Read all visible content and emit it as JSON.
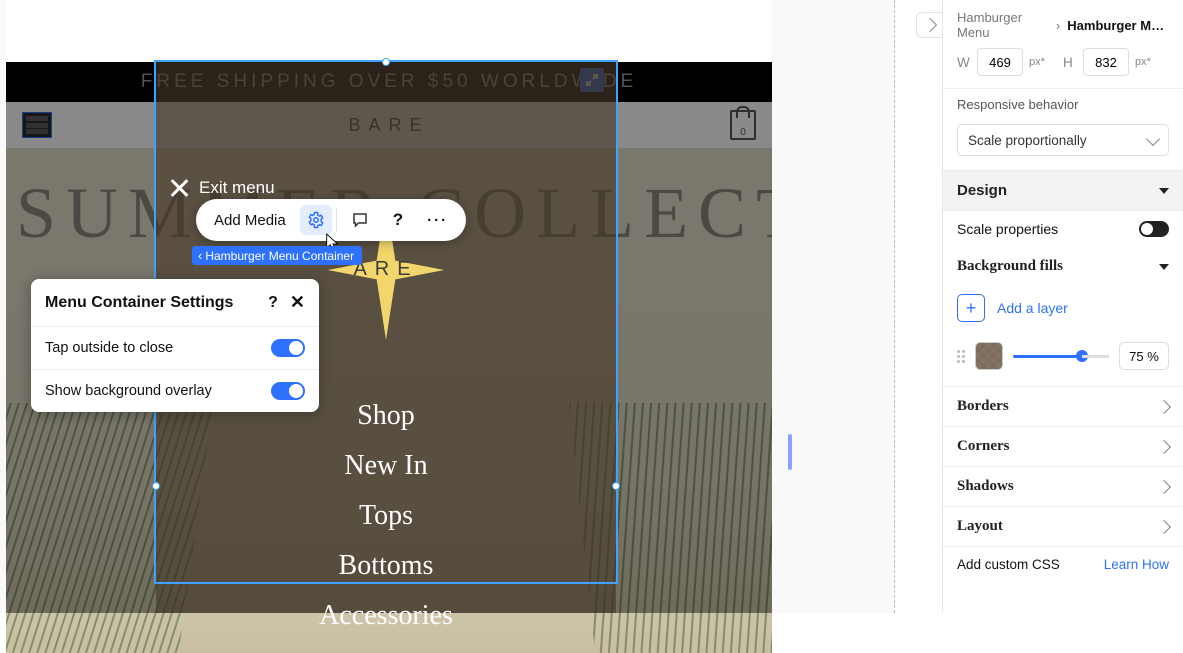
{
  "breadcrumb": {
    "parent": "Hamburger Menu",
    "current": "Hamburger Men…"
  },
  "size": {
    "w_label": "W",
    "w": "469",
    "w_unit": "px*",
    "h_label": "H",
    "h": "832",
    "h_unit": "px*"
  },
  "responsive": {
    "label": "Responsive behavior",
    "value": "Scale proportionally"
  },
  "design_section": "Design",
  "scale_props": {
    "label": "Scale properties"
  },
  "bg_fills": {
    "title": "Background fills",
    "add": "Add a layer",
    "opacity": "75 %"
  },
  "sections": {
    "borders": "Borders",
    "corners": "Corners",
    "shadows": "Shadows",
    "layout": "Layout"
  },
  "css": {
    "label": "Add custom CSS",
    "link": "Learn How"
  },
  "preview": {
    "banner": "FREE SHIPPING OVER $50 WORLDWIDE",
    "brand": "BARE",
    "brand_overlay": "ARE",
    "hero": "SUMMER COLLECTION",
    "bag_count": "0",
    "exit": "Exit menu",
    "menu": [
      "Shop",
      "New In",
      "Tops",
      "Bottoms",
      "Accessories"
    ]
  },
  "toolbar": {
    "add_media": "Add Media"
  },
  "tag": "Hamburger Menu Container",
  "popover": {
    "title": "Menu Container Settings",
    "row1": "Tap outside to close",
    "row2": "Show background overlay"
  }
}
